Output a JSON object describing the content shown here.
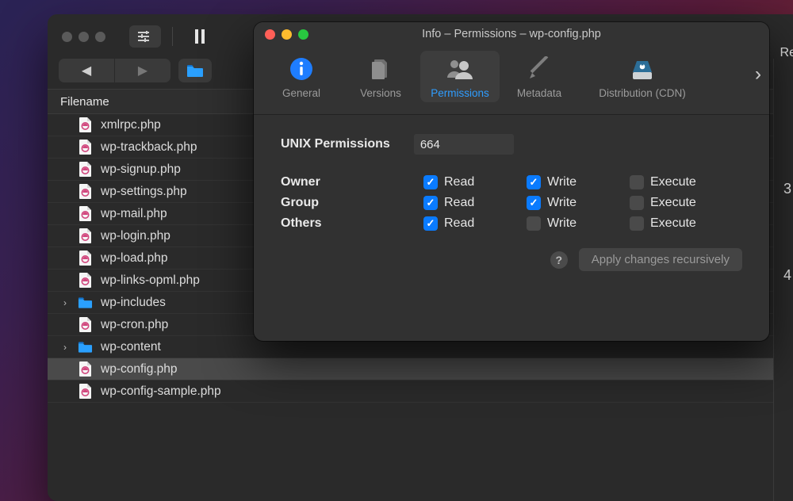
{
  "main": {
    "column_header": "Filename",
    "right_truncated_label": "Re",
    "right_numbers": [
      "3",
      "4"
    ],
    "files": [
      {
        "name": "xmlrpc.php",
        "type": "php",
        "selected": false,
        "expandable": false
      },
      {
        "name": "wp-trackback.php",
        "type": "php",
        "selected": false,
        "expandable": false
      },
      {
        "name": "wp-signup.php",
        "type": "php",
        "selected": false,
        "expandable": false
      },
      {
        "name": "wp-settings.php",
        "type": "php",
        "selected": false,
        "expandable": false
      },
      {
        "name": "wp-mail.php",
        "type": "php",
        "selected": false,
        "expandable": false
      },
      {
        "name": "wp-login.php",
        "type": "php",
        "selected": false,
        "expandable": false
      },
      {
        "name": "wp-load.php",
        "type": "php",
        "selected": false,
        "expandable": false
      },
      {
        "name": "wp-links-opml.php",
        "type": "php",
        "selected": false,
        "expandable": false
      },
      {
        "name": "wp-includes",
        "type": "folder",
        "selected": false,
        "expandable": true
      },
      {
        "name": "wp-cron.php",
        "type": "php",
        "selected": false,
        "expandable": false
      },
      {
        "name": "wp-content",
        "type": "folder",
        "selected": false,
        "expandable": true
      },
      {
        "name": "wp-config.php",
        "type": "php",
        "selected": true,
        "expandable": false
      },
      {
        "name": "wp-config-sample.php",
        "type": "php",
        "selected": false,
        "expandable": false
      }
    ]
  },
  "info": {
    "title": "Info – Permissions – wp-config.php",
    "tabs": {
      "general": "General",
      "versions": "Versions",
      "permissions": "Permissions",
      "metadata": "Metadata",
      "distribution": "Distribution (CDN)"
    },
    "unix_label": "UNIX Permissions",
    "unix_value": "664",
    "cols": {
      "read": "Read",
      "write": "Write",
      "execute": "Execute"
    },
    "rows": {
      "owner": {
        "label": "Owner",
        "read": true,
        "write": true,
        "execute": false
      },
      "group": {
        "label": "Group",
        "read": true,
        "write": true,
        "execute": false
      },
      "others": {
        "label": "Others",
        "read": true,
        "write": false,
        "execute": false
      }
    },
    "apply_label": "Apply changes recursively"
  }
}
